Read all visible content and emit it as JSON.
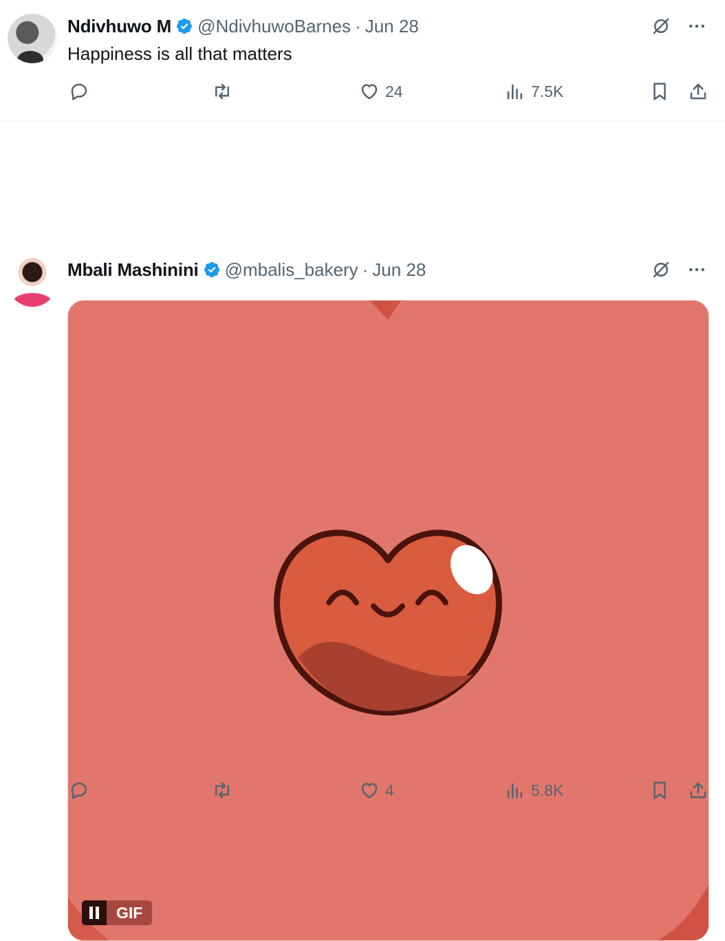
{
  "tweets": [
    {
      "author_name": "Ndivhuwo M",
      "handle": "@NdivhuwoBarnes",
      "separator": "·",
      "date": "Jun 28",
      "text": "Happiness is all that matters",
      "replies": "",
      "retweets": "",
      "likes": "24",
      "views": "7.5K"
    },
    {
      "author_name": "Mbali Mashinini",
      "handle": "@mbalis_bakery",
      "separator": "·",
      "date": "Jun 28",
      "likes": "4",
      "views": "5.8K",
      "media": {
        "type": "gif",
        "badge_label": "GIF",
        "background_color": "#e1766d",
        "heart_color": "#d95c3f"
      }
    }
  ],
  "colors": {
    "verified": "#1d9bf0",
    "muted_text": "#536471"
  },
  "icons": [
    "verified-badge-icon",
    "grok-icon",
    "more-icon",
    "reply-icon",
    "retweet-icon",
    "like-icon",
    "views-icon",
    "bookmark-icon",
    "share-icon",
    "pause-icon"
  ]
}
